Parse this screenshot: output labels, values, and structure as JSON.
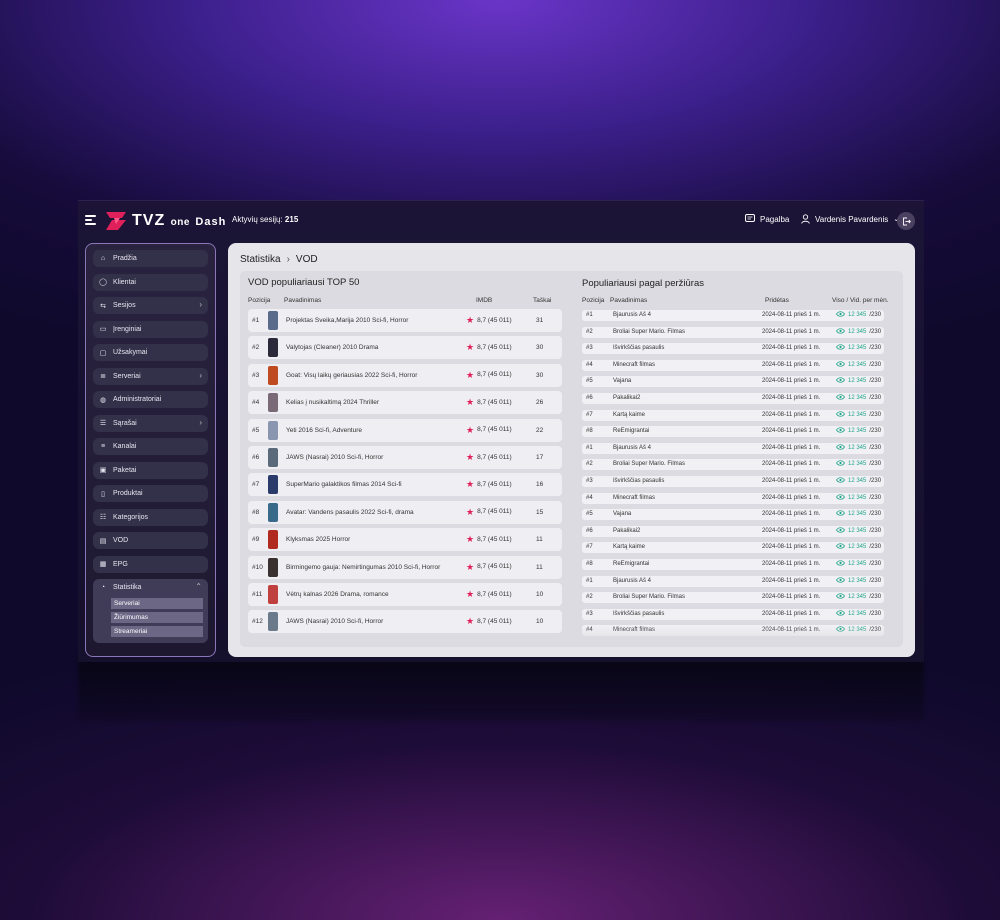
{
  "topbar": {
    "logo_main": "TVZ",
    "logo_sub": "one",
    "logo_tail": "Dash",
    "sessions_label": "Aktyvių sesijų:",
    "sessions_count": "215",
    "help_label": "Pagalba",
    "user_name": "Vardenis Pavardenis"
  },
  "sidebar": {
    "items": [
      {
        "label": "Pradžia",
        "icon": "home-icon"
      },
      {
        "label": "Klientai",
        "icon": "user-icon"
      },
      {
        "label": "Sesijos",
        "icon": "arrows-icon",
        "expandable": true
      },
      {
        "label": "Įrenginiai",
        "icon": "devices-icon"
      },
      {
        "label": "Užsakymai",
        "icon": "orders-icon"
      },
      {
        "label": "Serveriai",
        "icon": "server-icon",
        "expandable": true
      },
      {
        "label": "Administratoriai",
        "icon": "admin-icon"
      },
      {
        "label": "Sąrašai",
        "icon": "list-icon",
        "expandable": true
      },
      {
        "label": "Kanalai",
        "icon": "channels-icon"
      },
      {
        "label": "Paketai",
        "icon": "package-icon"
      },
      {
        "label": "Produktai",
        "icon": "product-icon"
      },
      {
        "label": "Kategorijos",
        "icon": "categories-icon"
      },
      {
        "label": "VOD",
        "icon": "vod-icon"
      },
      {
        "label": "EPG",
        "icon": "epg-icon"
      }
    ],
    "active": {
      "label": "Statistika",
      "icon": "stats-icon"
    },
    "submenu": [
      "Serveriai",
      "Žiūrimumas",
      "Streameriai"
    ]
  },
  "breadcrumb": {
    "root": "Statistika",
    "current": "VOD"
  },
  "vod_top": {
    "title": "VOD populiariausi TOP 50",
    "headers": {
      "pos": "Pozicija",
      "name": "Pavadinimas",
      "imdb": "IMDB",
      "points": "Taškai"
    },
    "rows": [
      {
        "pos": "#1",
        "title": "Projektas Sveika,Marija   2010   Sci-fi, Horror",
        "imdb": "8,7  (45 011)",
        "points": "31",
        "color": "#5a6a8a"
      },
      {
        "pos": "#2",
        "title": "Valytojas (Cleaner)   2010   Drama",
        "imdb": "8,7  (45 011)",
        "points": "30",
        "color": "#2a2a3a"
      },
      {
        "pos": "#3",
        "title": "Goat: Visų laikų geriausias   2022   Sci-fi, Horror",
        "imdb": "8,7  (45 011)",
        "points": "30",
        "color": "#c04a20"
      },
      {
        "pos": "#4",
        "title": "Kelias į nusikaltimą   2024   Thriller",
        "imdb": "8,7  (45 011)",
        "points": "26",
        "color": "#7a6a78"
      },
      {
        "pos": "#5",
        "title": "Yeti   2016   Sci-fi, Adventure",
        "imdb": "8,7  (45 011)",
        "points": "22",
        "color": "#8a96b0"
      },
      {
        "pos": "#6",
        "title": "JAWS (Nasrai)   2010   Sci-fi, Horror",
        "imdb": "8,7  (45 011)",
        "points": "17",
        "color": "#5a6a7a"
      },
      {
        "pos": "#7",
        "title": "SuperMario galaktikos filmas   2014   Sci-fi",
        "imdb": "8,7  (45 011)",
        "points": "16",
        "color": "#2a3a6a"
      },
      {
        "pos": "#8",
        "title": "Avatar: Vandens pasaulis   2022   Sci-fi, drama",
        "imdb": "8,7  (45 011)",
        "points": "15",
        "color": "#3a6a8a"
      },
      {
        "pos": "#9",
        "title": "Klyksmas   2025   Horror",
        "imdb": "8,7  (45 011)",
        "points": "11",
        "color": "#b02a20"
      },
      {
        "pos": "#10",
        "title": "Birmingemo gauja: Nemirtingumas   2010   Sci-fi, Horror",
        "imdb": "8,7  (45 011)",
        "points": "11",
        "color": "#3a3030"
      },
      {
        "pos": "#11",
        "title": "Vėtrų kalnas   2026   Drama, romance",
        "imdb": "8,7  (45 011)",
        "points": "10",
        "color": "#c04040"
      },
      {
        "pos": "#12",
        "title": "JAWS (Nasrai)   2010   Sci-fi, Horror",
        "imdb": "8,7  (45 011)",
        "points": "10",
        "color": "#6a7a8a"
      }
    ]
  },
  "popular": {
    "title": "Populiariausi pagal peržiūras",
    "headers": {
      "pos": "Pozicija",
      "name": "Pavadinimas",
      "added": "Pridėtas",
      "views": "Viso / Vid. per mėn."
    },
    "added_value": "2024-08-11 prieš 1 m.",
    "views_total": "12 345",
    "views_avg": "/230",
    "rows": [
      {
        "pos": "#1",
        "title": "Bjaurusis Aš 4"
      },
      {
        "pos": "#2",
        "title": "Broliai Super Mario. Filmas"
      },
      {
        "pos": "#3",
        "title": "Išvirkščias pasaulis"
      },
      {
        "pos": "#4",
        "title": "Minecraft filmas"
      },
      {
        "pos": "#5",
        "title": "Vajana"
      },
      {
        "pos": "#6",
        "title": "Pakalikai2"
      },
      {
        "pos": "#7",
        "title": "Kartą kaime"
      },
      {
        "pos": "#8",
        "title": "ReEmigrantai"
      },
      {
        "pos": "#1",
        "title": "Bjaurusis Aš 4"
      },
      {
        "pos": "#2",
        "title": "Broliai Super Mario. Filmas"
      },
      {
        "pos": "#3",
        "title": "Išvirkščias pasaulis"
      },
      {
        "pos": "#4",
        "title": "Minecraft filmas"
      },
      {
        "pos": "#5",
        "title": "Vajana"
      },
      {
        "pos": "#6",
        "title": "Pakalikai2"
      },
      {
        "pos": "#7",
        "title": "Kartą kaime"
      },
      {
        "pos": "#8",
        "title": "ReEmigrantai"
      },
      {
        "pos": "#1",
        "title": "Bjaurusis Aš 4"
      },
      {
        "pos": "#2",
        "title": "Broliai Super Mario. Filmas"
      },
      {
        "pos": "#3",
        "title": "Išvirkščias pasaulis"
      },
      {
        "pos": "#4",
        "title": "Minecraft filmas"
      }
    ]
  },
  "colors": {
    "accent": "#e0205a",
    "views": "#1fa58a",
    "brand_purple": "#6a35c8"
  }
}
